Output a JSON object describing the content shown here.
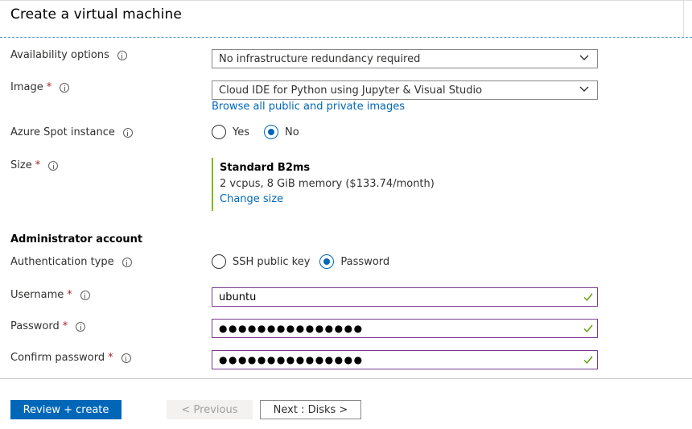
{
  "header": {
    "title": "Create a virtual machine"
  },
  "form": {
    "availability": {
      "label": "Availability options",
      "value": "No infrastructure redundancy required"
    },
    "image": {
      "label": "Image",
      "required_mark": "*",
      "value": "Cloud IDE for Python using Jupyter & Visual Studio",
      "browse_link": "Browse all public and private images"
    },
    "spot": {
      "label": "Azure Spot instance",
      "options": [
        "Yes",
        "No"
      ],
      "selected": "No"
    },
    "size": {
      "label": "Size",
      "required_mark": "*",
      "name": "Standard B2ms",
      "description": "2 vcpus, 8 GiB memory ($133.74/month)",
      "change_link": "Change size"
    },
    "admin": {
      "section_title": "Administrator account",
      "auth_label": "Authentication type",
      "auth_options": [
        "SSH public key",
        "Password"
      ],
      "auth_selected": "Password",
      "username_label": "Username",
      "username_value": "ubuntu",
      "password_label": "Password",
      "password_value": "●●●●●●●●●●●●●●●",
      "confirm_label": "Confirm password",
      "confirm_value": "●●●●●●●●●●●●●●●",
      "required_mark": "*"
    }
  },
  "footer": {
    "review_label": "Review + create",
    "previous_label": "< Previous",
    "next_label": "Next : Disks >"
  },
  "colors": {
    "accent": "#0067b8",
    "required": "#a4262c",
    "size_bar": "#7fba00",
    "valid_check": "#57a300",
    "input_border": "#7a3b92"
  }
}
